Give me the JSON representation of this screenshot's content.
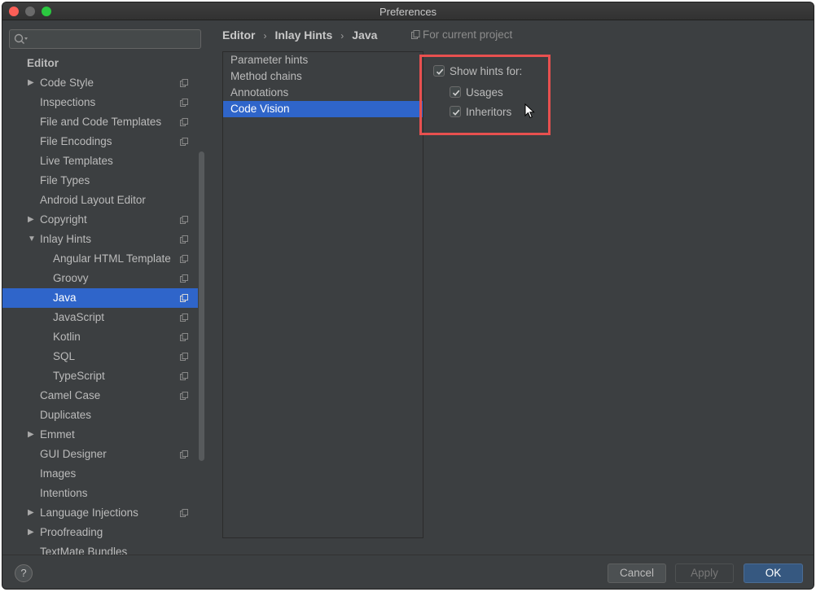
{
  "window": {
    "title": "Preferences"
  },
  "search": {
    "placeholder": ""
  },
  "sidebar": {
    "items": [
      {
        "label": "Editor",
        "level": 0,
        "header": true
      },
      {
        "label": "Code Style",
        "level": 1,
        "arrow": "collapsed",
        "project_scope": true
      },
      {
        "label": "Inspections",
        "level": 1,
        "project_scope": true
      },
      {
        "label": "File and Code Templates",
        "level": 1,
        "project_scope": true
      },
      {
        "label": "File Encodings",
        "level": 1,
        "project_scope": true
      },
      {
        "label": "Live Templates",
        "level": 1
      },
      {
        "label": "File Types",
        "level": 1
      },
      {
        "label": "Android Layout Editor",
        "level": 1
      },
      {
        "label": "Copyright",
        "level": 1,
        "arrow": "collapsed",
        "project_scope": true
      },
      {
        "label": "Inlay Hints",
        "level": 1,
        "arrow": "expanded",
        "project_scope": true
      },
      {
        "label": "Angular HTML Template",
        "level": 2,
        "project_scope": true
      },
      {
        "label": "Groovy",
        "level": 2,
        "project_scope": true
      },
      {
        "label": "Java",
        "level": 2,
        "project_scope": true,
        "selected": true
      },
      {
        "label": "JavaScript",
        "level": 2,
        "project_scope": true
      },
      {
        "label": "Kotlin",
        "level": 2,
        "project_scope": true
      },
      {
        "label": "SQL",
        "level": 2,
        "project_scope": true
      },
      {
        "label": "TypeScript",
        "level": 2,
        "project_scope": true
      },
      {
        "label": "Camel Case",
        "level": 1,
        "project_scope": true
      },
      {
        "label": "Duplicates",
        "level": 1
      },
      {
        "label": "Emmet",
        "level": 1,
        "arrow": "collapsed"
      },
      {
        "label": "GUI Designer",
        "level": 1,
        "project_scope": true
      },
      {
        "label": "Images",
        "level": 1
      },
      {
        "label": "Intentions",
        "level": 1
      },
      {
        "label": "Language Injections",
        "level": 1,
        "arrow": "collapsed",
        "project_scope": true
      },
      {
        "label": "Proofreading",
        "level": 1,
        "arrow": "collapsed"
      },
      {
        "label": "TextMate Bundles",
        "level": 1
      }
    ]
  },
  "breadcrumb": {
    "items": [
      "Editor",
      "Inlay Hints",
      "Java"
    ],
    "scope_label": "For current project"
  },
  "hints_list": {
    "items": [
      "Parameter hints",
      "Method chains",
      "Annotations",
      "Code Vision"
    ],
    "selected": "Code Vision"
  },
  "options": {
    "show_hints_label": "Show hints for:",
    "show_hints_checked": true,
    "usages_label": "Usages",
    "usages_checked": true,
    "inheritors_label": "Inheritors",
    "inheritors_checked": true
  },
  "footer": {
    "help_label": "?",
    "cancel_label": "Cancel",
    "apply_label": "Apply",
    "ok_label": "OK"
  },
  "colors": {
    "background": "#3c3f41",
    "selection": "#2f65ca",
    "highlight_box": "#e8504f",
    "ok_button": "#365880"
  }
}
